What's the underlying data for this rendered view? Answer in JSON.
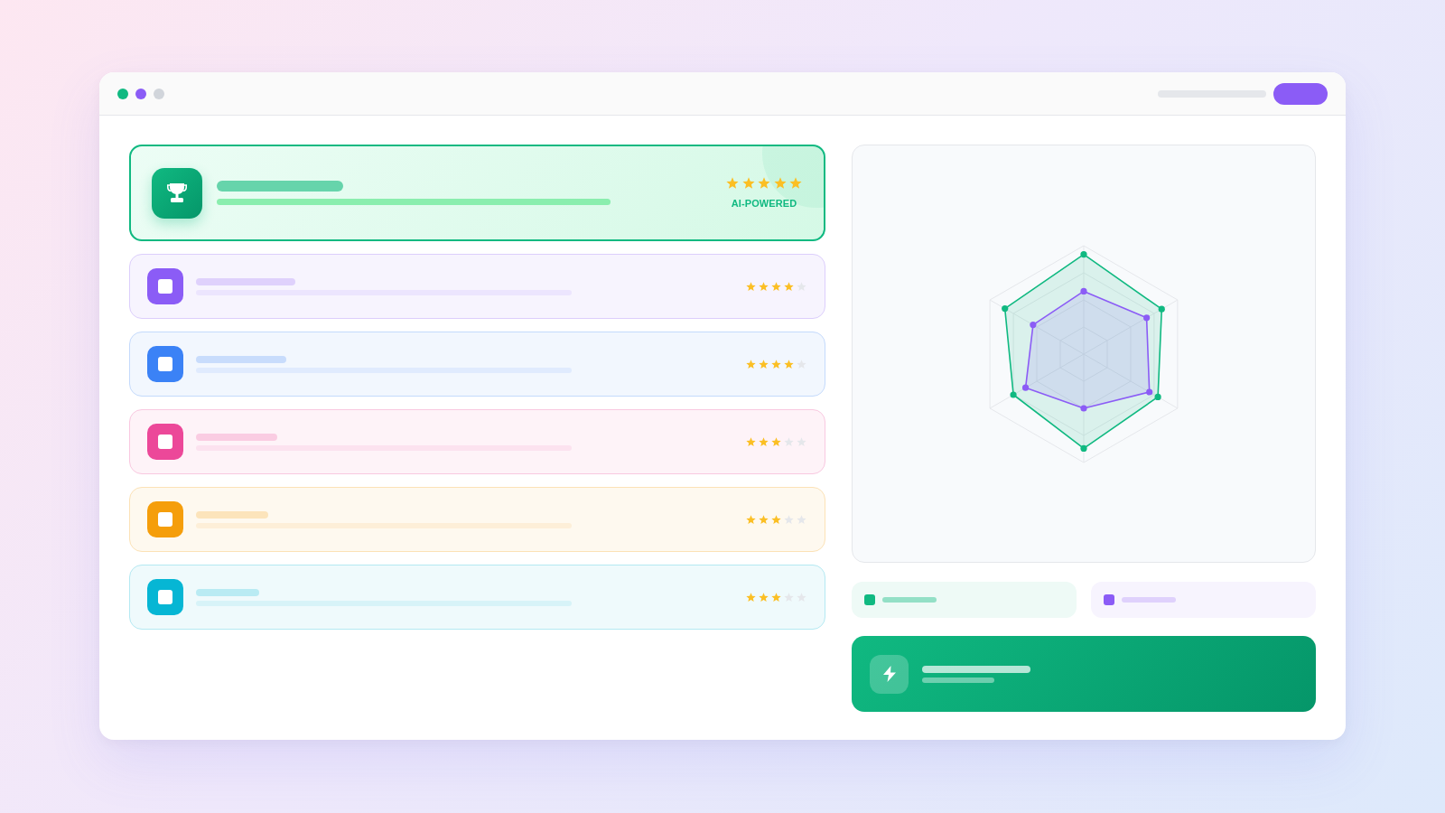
{
  "window": {
    "controls": [
      {
        "color": "#10b981"
      },
      {
        "color": "#8b5cf6"
      },
      {
        "color": "#d1d5db"
      }
    ]
  },
  "featured": {
    "stars": 5,
    "label": "AI-POWERED"
  },
  "items": [
    {
      "color": "#8b5cf6",
      "stars": 4
    },
    {
      "color": "#3b82f6",
      "stars": 4
    },
    {
      "color": "#ec4899",
      "stars": 3
    },
    {
      "color": "#f59e0b",
      "stars": 3
    },
    {
      "color": "#06b6d4",
      "stars": 3
    }
  ],
  "legend": [
    {
      "color": "#10b981"
    },
    {
      "color": "#8b5cf6"
    }
  ]
}
